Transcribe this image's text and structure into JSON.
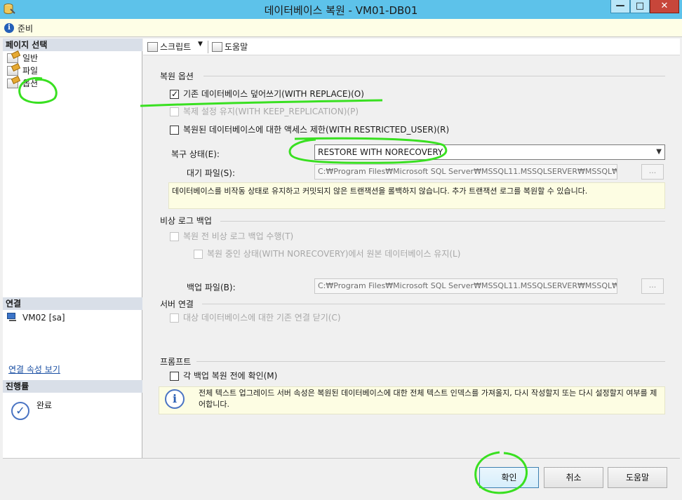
{
  "window": {
    "title": "데이터베이스 복원 - VM01-DB01",
    "minimize_glyph": "—",
    "maximize_glyph": "□",
    "close_glyph": "✕"
  },
  "status": {
    "text": "준비",
    "icon": "info-icon"
  },
  "left_panel": {
    "page_select_header": "페이지 선택",
    "pages": [
      {
        "label": "일반",
        "icon": "page-icon"
      },
      {
        "label": "파일",
        "icon": "page-icon"
      },
      {
        "label": "옵션",
        "icon": "page-icon"
      }
    ],
    "connection_header": "연결",
    "connection_item": "VM02 [sa]",
    "connection_link": "연결 속성 보기",
    "progress_header": "진행률",
    "progress_status": "완료"
  },
  "toolbar": {
    "script_label": "스크립트",
    "help_label": "도움말"
  },
  "restore_options": {
    "group_title": "복원 옵션",
    "with_replace": {
      "label": "기존 데이터베이스 덮어쓰기(WITH REPLACE)(O)",
      "checked": true,
      "enabled": true
    },
    "keep_replication": {
      "label": "복제 설정 유지(WITH KEEP_REPLICATION)(P)",
      "checked": false,
      "enabled": false
    },
    "restricted_user": {
      "label": "복원된 데이터베이스에 대한 액세스 제한(WITH RESTRICTED_USER)(R)",
      "checked": false,
      "enabled": true
    },
    "recovery_state_label": "복구 상태(E):",
    "recovery_state_value": "RESTORE WITH NORECOVERY",
    "standby_file_label": "대기 파일(S):",
    "standby_file_value": "C:₩Program Files₩Microsoft SQL Server₩MSSQL11.MSSQLSERVER₩MSSQL₩B",
    "browse_label": "...",
    "recovery_note": "데이터베이스를 비작동 상태로 유지하고 커밋되지 않은 트랜잭션을 롤백하지 않습니다. 추가 트랜잭션 로그를 복원할 수 있습니다."
  },
  "tail_log": {
    "group_title": "비상 로그 백업",
    "take_tail_log": {
      "label": "복원 전 비상 로그 백업 수행(T)",
      "checked": false,
      "enabled": false
    },
    "leave_source": {
      "label": "복원 중인 상태(WITH NORECOVERY)에서 원본 데이터베이스 유지(L)",
      "checked": false,
      "enabled": false
    },
    "backup_file_label": "백업 파일(B):",
    "backup_file_value": "C:₩Program Files₩Microsoft SQL Server₩MSSQL11.MSSQLSERVER₩MSSQL₩B",
    "browse_label": "..."
  },
  "server_connections": {
    "group_title": "서버 연결",
    "close_existing": {
      "label": "대상 데이터베이스에 대한 기존 연결 닫기(C)",
      "checked": false,
      "enabled": false
    }
  },
  "prompt": {
    "group_title": "프롬프트",
    "confirm_each": {
      "label": "각 백업 복원 전에 확인(M)",
      "checked": false,
      "enabled": true
    },
    "fulltext_note": "전체 텍스트 업그레이드 서버 속성은 복원된 데이터베이스에 대한 전체 텍스트 인덱스를 가져올지, 다시 작성할지 또는 다시 설정할지 여부를 제어합니다."
  },
  "buttons": {
    "ok": "확인",
    "cancel": "취소",
    "help": "도움말"
  },
  "colors": {
    "titlebar": "#5dc2ea",
    "annotation": "#39e021",
    "link": "#1a4fa3"
  }
}
